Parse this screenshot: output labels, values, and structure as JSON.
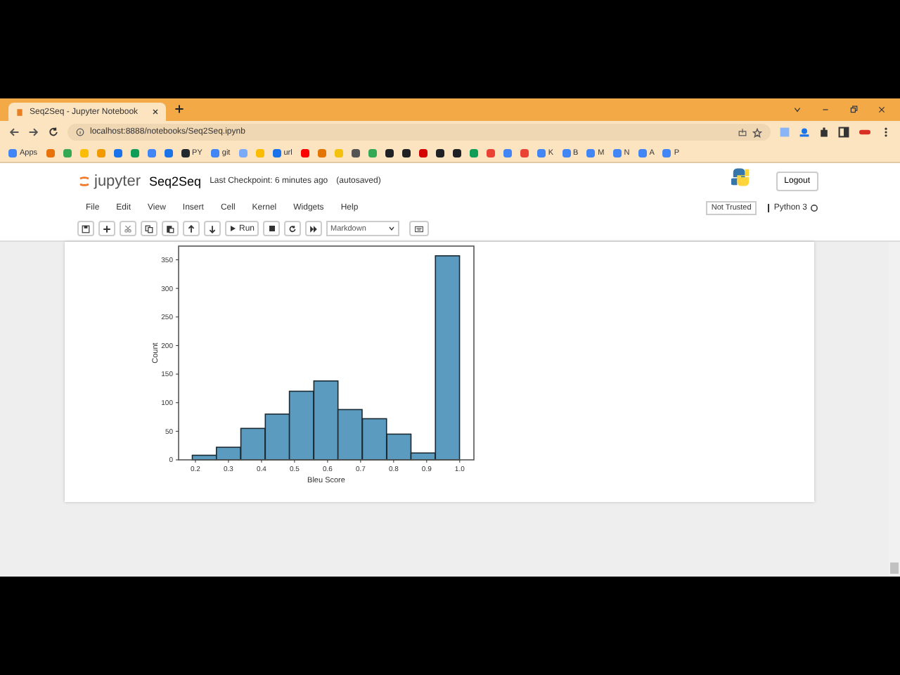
{
  "browser": {
    "tab_title": "Seq2Seq - Jupyter Notebook",
    "url": "localhost:8888/notebooks/Seq2Seq.ipynb",
    "bookmarks": [
      {
        "label": "Apps",
        "color": "#4285f4"
      },
      {
        "color": "#e8710a"
      },
      {
        "color": "#34a853"
      },
      {
        "color": "#fbbc04"
      },
      {
        "color": "#f29900"
      },
      {
        "color": "#1a73e8"
      },
      {
        "color": "#0f9d58"
      },
      {
        "color": "#4285f4"
      },
      {
        "color": "#1a73e8"
      },
      {
        "label": "PY",
        "color": "#24292e"
      },
      {
        "label": "git",
        "color": "#4285f4"
      },
      {
        "color": "#7baaf7"
      },
      {
        "color": "#fbbc04"
      },
      {
        "label": "url",
        "color": "#1a73e8"
      },
      {
        "color": "#ff0000"
      },
      {
        "color": "#e37400"
      },
      {
        "color": "#f4c20d"
      },
      {
        "color": "#555555"
      },
      {
        "color": "#34a853"
      },
      {
        "color": "#202124"
      },
      {
        "color": "#202124"
      },
      {
        "color": "#d50000"
      },
      {
        "color": "#202124"
      },
      {
        "color": "#202124"
      },
      {
        "color": "#0f9d58"
      },
      {
        "color": "#ea4335"
      },
      {
        "color": "#4285f4"
      },
      {
        "color": "#ea4335"
      },
      {
        "label": "K",
        "color": "#4285f4"
      },
      {
        "label": "B",
        "color": "#4285f4"
      },
      {
        "label": "M",
        "color": "#4285f4"
      },
      {
        "label": "N",
        "color": "#4285f4"
      },
      {
        "label": "A",
        "color": "#4285f4"
      },
      {
        "label": "P",
        "color": "#4285f4"
      }
    ]
  },
  "header": {
    "logo_text": "jupyter",
    "notebook_name": "Seq2Seq",
    "checkpoint": "Last Checkpoint: 6 minutes ago",
    "autosave": "(autosaved)",
    "logout": "Logout"
  },
  "menu": [
    "File",
    "Edit",
    "View",
    "Insert",
    "Cell",
    "Kernel",
    "Widgets",
    "Help"
  ],
  "trust": "Not Trusted",
  "kernel": "Python 3",
  "toolbar": {
    "run": "Run",
    "cell_type": "Markdown"
  },
  "output": {
    "chart_data": {
      "type": "bar",
      "xlabel": "Bleu Score",
      "ylabel": "Count",
      "x": [
        0.227,
        0.3,
        0.374,
        0.448,
        0.521,
        0.595,
        0.668,
        0.742,
        0.816,
        0.889,
        0.963
      ],
      "series": [
        {
          "color": "#5b9bbf",
          "values": [
            8,
            22,
            55,
            80,
            120,
            138,
            88,
            72,
            45,
            12,
            357
          ]
        }
      ],
      "xlim": [
        0.149,
        1.043
      ],
      "ylim": [
        0,
        374
      ],
      "xticks": [
        {
          "value": 0.2,
          "label": "0.2"
        },
        {
          "value": 0.3,
          "label": "0.3"
        },
        {
          "value": 0.4,
          "label": "0.4"
        },
        {
          "value": 0.5,
          "label": "0.5"
        },
        {
          "value": 0.6,
          "label": "0.6"
        },
        {
          "value": 0.7,
          "label": "0.7"
        },
        {
          "value": 0.8,
          "label": "0.8"
        },
        {
          "value": 0.9,
          "label": "0.9"
        },
        {
          "value": 1.0,
          "label": "1.0"
        }
      ],
      "yticks": [
        0,
        50,
        100,
        150,
        200,
        250,
        300,
        350
      ]
    }
  }
}
